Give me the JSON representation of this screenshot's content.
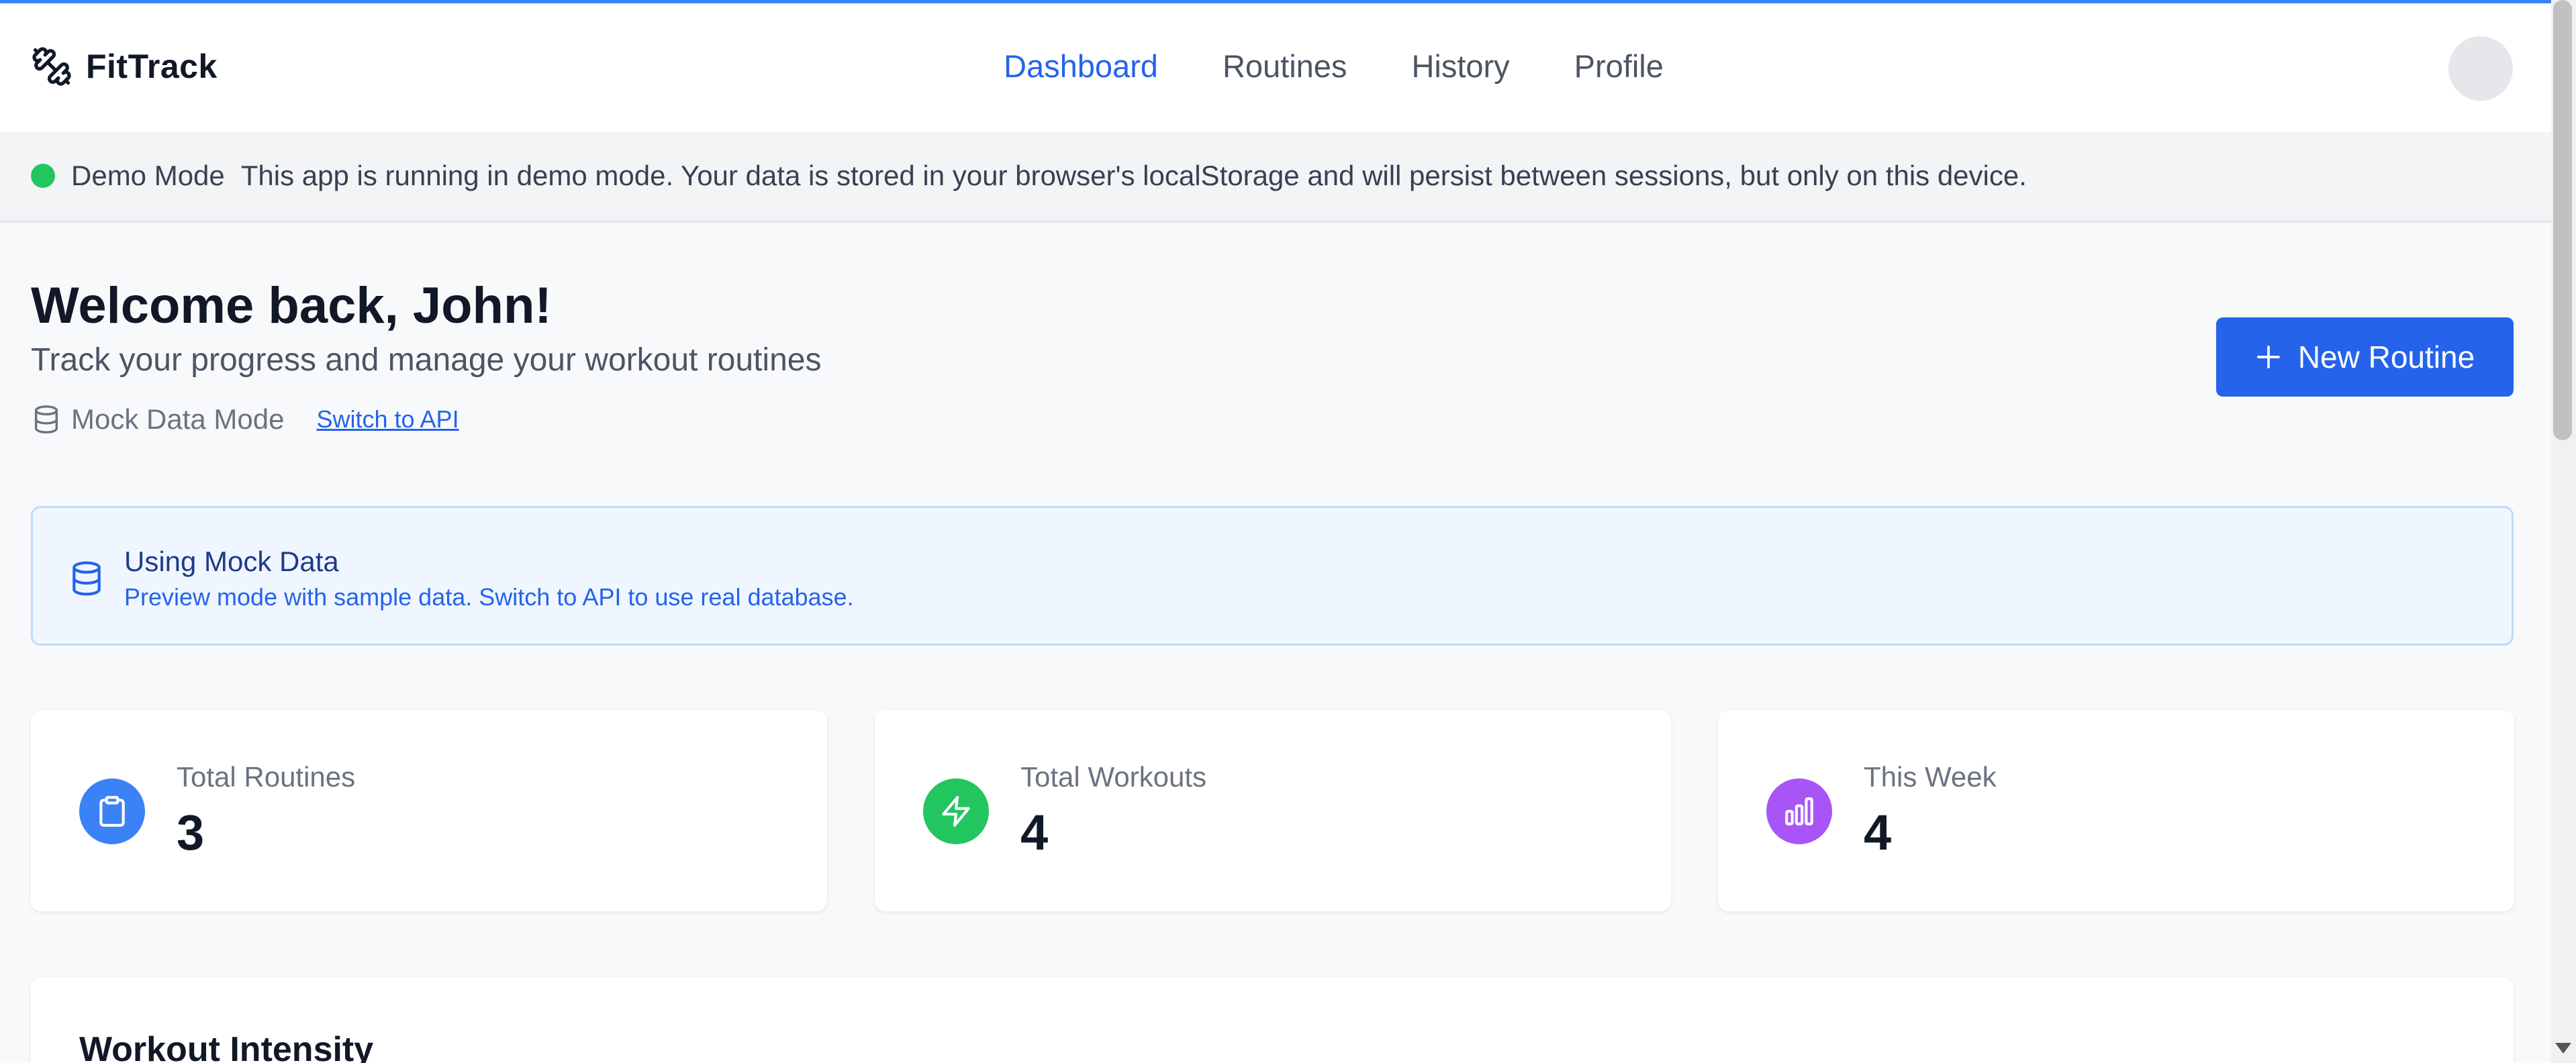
{
  "app": {
    "name": "FitTrack"
  },
  "nav": {
    "items": [
      {
        "label": "Dashboard",
        "active": true
      },
      {
        "label": "Routines",
        "active": false
      },
      {
        "label": "History",
        "active": false
      },
      {
        "label": "Profile",
        "active": false
      }
    ]
  },
  "demo_banner": {
    "label": "Demo Mode",
    "message": "This app is running in demo mode. Your data is stored in your browser's localStorage and will persist between sessions, but only on this device."
  },
  "welcome": {
    "title": "Welcome back, John!",
    "subtitle": "Track your progress and manage your workout routines",
    "mode_label": "Mock Data Mode",
    "switch_link": "Switch to API"
  },
  "new_routine_button": {
    "label": "New Routine"
  },
  "info_box": {
    "title": "Using Mock Data",
    "description": "Preview mode with sample data. Switch to API to use real database."
  },
  "stats": [
    {
      "label": "Total Routines",
      "value": "3",
      "icon": "clipboard-icon",
      "color": "#3b82f6"
    },
    {
      "label": "Total Workouts",
      "value": "4",
      "icon": "lightning-icon",
      "color": "#22c55e"
    },
    {
      "label": "This Week",
      "value": "4",
      "icon": "bar-chart-icon",
      "color": "#a855f7"
    }
  ],
  "intensity": {
    "title": "Workout Intensity"
  },
  "colors": {
    "primary": "#2563eb",
    "demo_dot": "#22c55e"
  }
}
